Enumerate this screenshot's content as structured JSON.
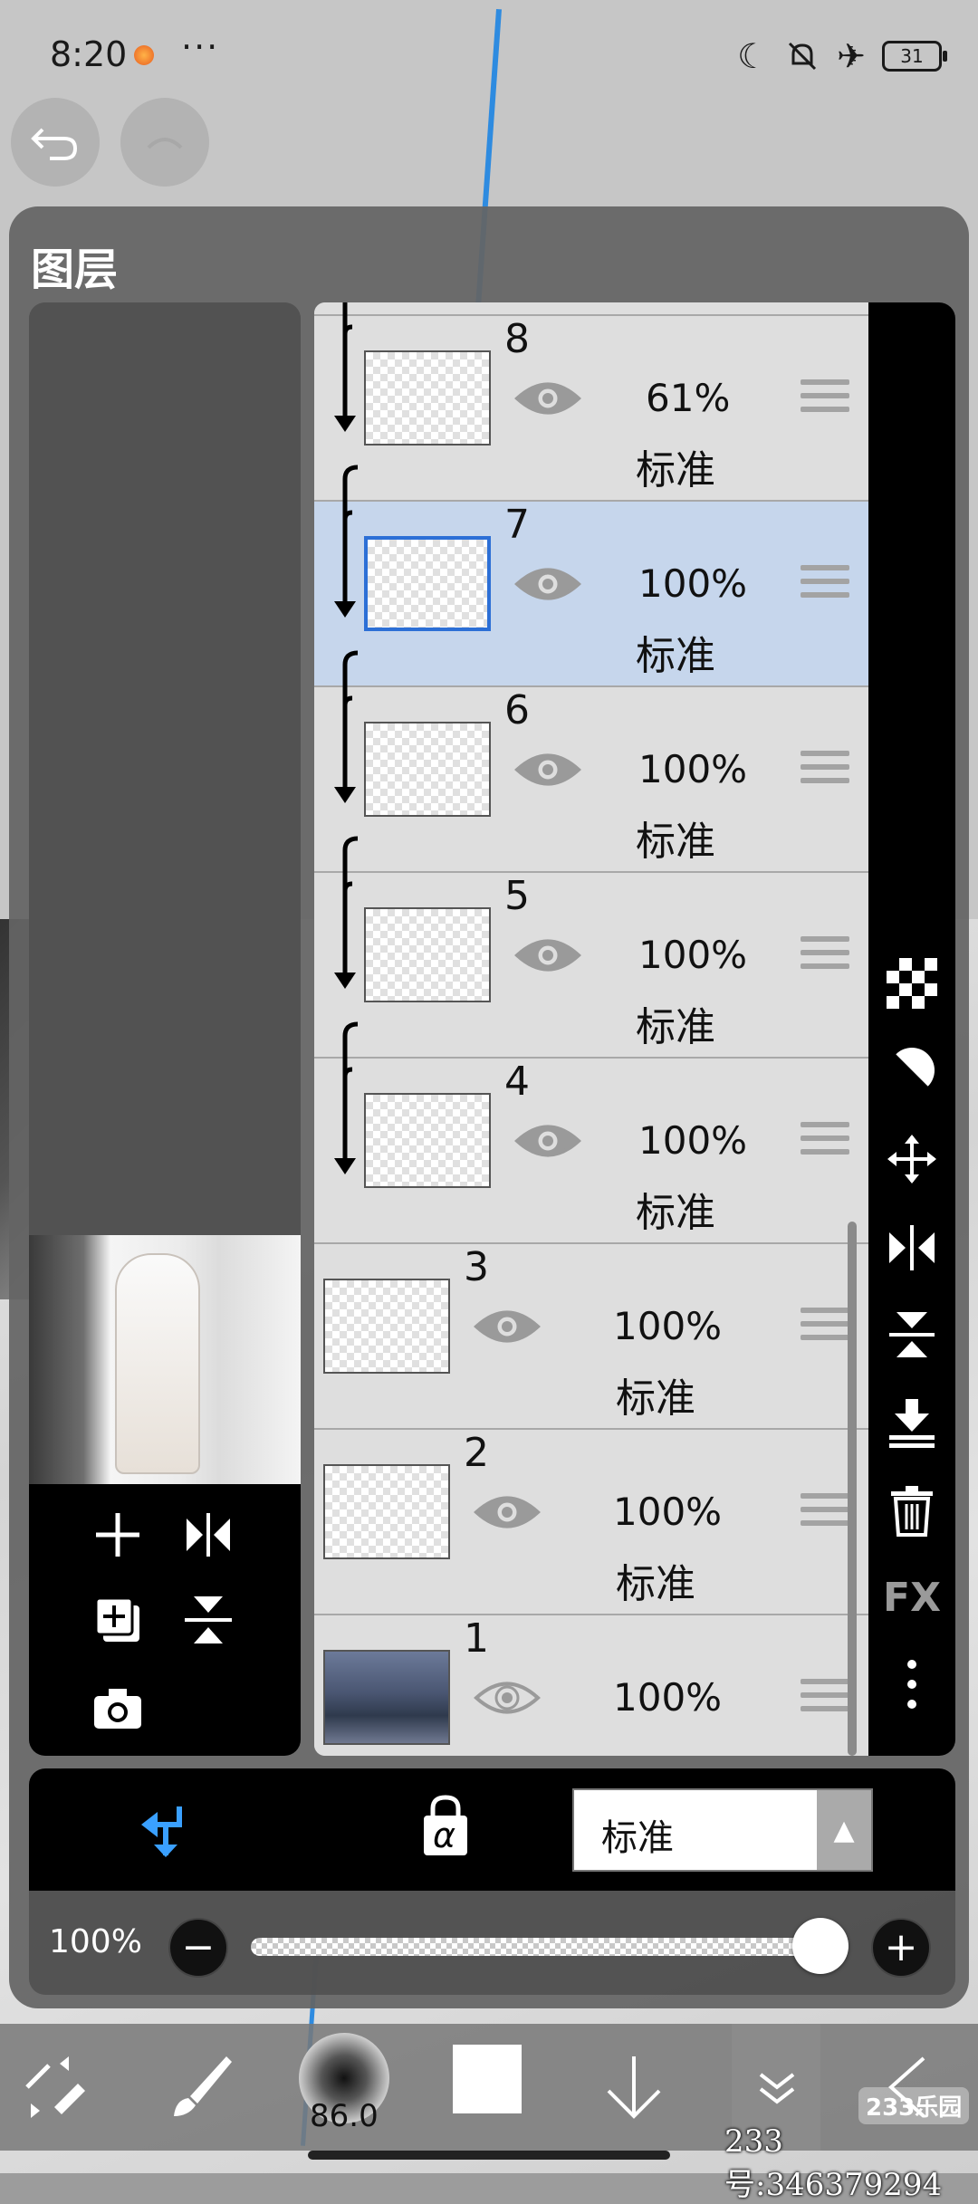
{
  "status_bar": {
    "time": "8:20",
    "more": "···",
    "icons": [
      "moon-icon",
      "mute-icon",
      "airplane-icon"
    ],
    "battery": "31"
  },
  "panel": {
    "title": "图层",
    "layers": [
      {
        "number": "8",
        "opacity": "61%",
        "mode": "标准",
        "selected": false
      },
      {
        "number": "7",
        "opacity": "100%",
        "mode": "标准",
        "selected": true
      },
      {
        "number": "6",
        "opacity": "100%",
        "mode": "标准",
        "selected": false
      },
      {
        "number": "5",
        "opacity": "100%",
        "mode": "标准",
        "selected": false
      },
      {
        "number": "4",
        "opacity": "100%",
        "mode": "标准",
        "selected": false
      },
      {
        "number": "3",
        "opacity": "100%",
        "mode": "标准",
        "selected": false
      },
      {
        "number": "2",
        "opacity": "100%",
        "mode": "标准",
        "selected": false
      },
      {
        "number": "1",
        "opacity": "100%",
        "mode": "",
        "selected": false
      }
    ],
    "top_partial_mode": "标准",
    "right_tools": [
      "checker-icon",
      "contrast-icon",
      "move-icon",
      "flip-horizontal-icon",
      "flip-vertical-icon",
      "merge-down-icon",
      "trash-icon",
      "fx-icon",
      "more-vertical-icon"
    ],
    "fx_label": "FX",
    "left_tools": [
      "add-layer-icon",
      "flip-layer-icon",
      "duplicate-layer-icon",
      "compress-icon",
      "camera-icon"
    ]
  },
  "blend": {
    "mode": "标准",
    "alpha_symbol": "α"
  },
  "opacity": {
    "label": "100%",
    "value": 1.0,
    "minus": "−",
    "plus": "+"
  },
  "bottom_toolbar": {
    "brush_size": "86.0",
    "watermark_logo": "233乐园",
    "watermark_id": "233号:346379294"
  },
  "colors": {
    "accent": "#2c6fd6",
    "selected_row": "#c6d6ec",
    "clip_arrow": "#3aa0ff"
  }
}
